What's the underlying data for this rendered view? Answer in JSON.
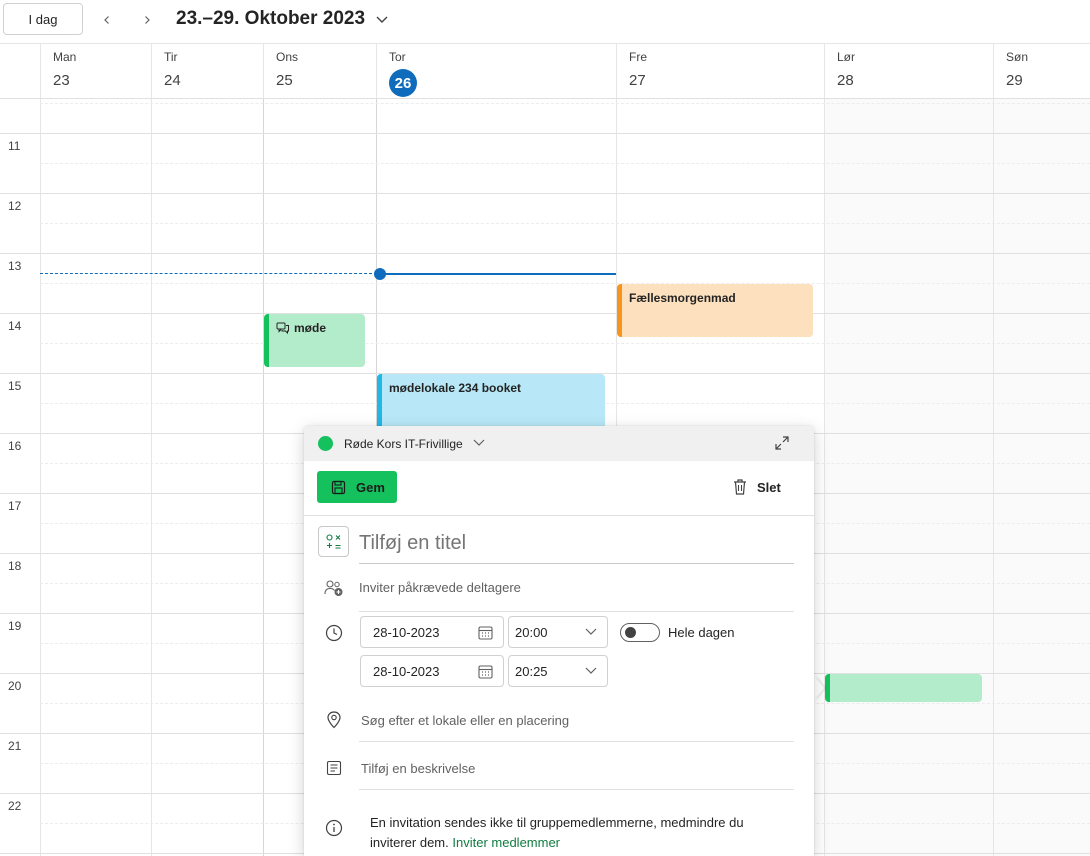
{
  "toolbar": {
    "today_label": "I dag",
    "prev_icon": "chevron-left-icon",
    "next_icon": "chevron-right-icon",
    "date_range": "23.–29. Oktober 2023"
  },
  "days": [
    {
      "name": "Man",
      "num": "23",
      "today": false
    },
    {
      "name": "Tir",
      "num": "24",
      "today": false
    },
    {
      "name": "Ons",
      "num": "25",
      "today": false
    },
    {
      "name": "Tor",
      "num": "26",
      "today": true
    },
    {
      "name": "Fre",
      "num": "27",
      "today": false
    },
    {
      "name": "Lør",
      "num": "28",
      "today": false
    },
    {
      "name": "Søn",
      "num": "29",
      "today": false
    }
  ],
  "hours": [
    "11",
    "12",
    "13",
    "14",
    "15",
    "16",
    "17",
    "18",
    "19",
    "20",
    "21",
    "22"
  ],
  "events": [
    {
      "title": "møde",
      "day": "Ons",
      "color": "#b3eccb",
      "bar": "#15c15d",
      "icon": "chat-icon"
    },
    {
      "title": "Fællesmorgenmad",
      "day": "Fre",
      "color": "#fde0bd",
      "bar": "#f7941d"
    },
    {
      "title": "mødelokale 234 booket",
      "day": "Tor",
      "color": "#b8e8f7",
      "bar": "#1fb8e9"
    },
    {
      "title": "",
      "day": "Lør",
      "color": "#b3eccb",
      "bar": "#15c15d"
    }
  ],
  "colors": {
    "accent": "#0f6cbd",
    "save_green": "#15c15d",
    "link_green": "#107c41"
  },
  "popup": {
    "calendar_name": "Røde Kors IT-Frivillige",
    "save_label": "Gem",
    "delete_label": "Slet",
    "title_placeholder": "Tilføj en titel",
    "attendees_placeholder": "Inviter påkrævede deltagere",
    "start_date": "28-10-2023",
    "start_time": "20:00",
    "end_date": "28-10-2023",
    "end_time": "20:25",
    "all_day_label": "Hele dagen",
    "location_placeholder": "Søg efter et lokale eller en placering",
    "description_placeholder": "Tilføj en beskrivelse",
    "info_text": "En invitation sendes ikke til gruppemedlemmerne, medmindre du inviterer dem.",
    "info_link": "Inviter medlemmer"
  }
}
